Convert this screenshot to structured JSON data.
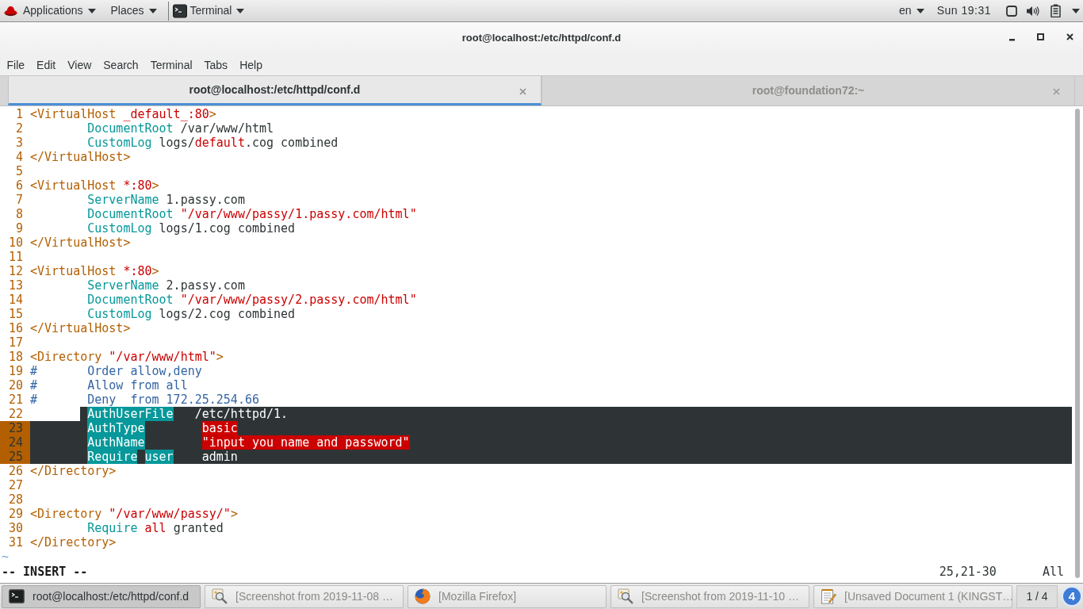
{
  "top_bar": {
    "menus": [
      {
        "label": "Applications"
      },
      {
        "label": "Places"
      }
    ],
    "app_menu": {
      "label": "Terminal"
    },
    "keyboard": "en",
    "clock": "Sun 19:31"
  },
  "window": {
    "title": "root@localhost:/etc/httpd/conf.d"
  },
  "menu_bar": [
    "File",
    "Edit",
    "View",
    "Search",
    "Terminal",
    "Tabs",
    "Help"
  ],
  "tabs": [
    {
      "label": "root@localhost:/etc/httpd/conf.d",
      "selected": true
    },
    {
      "label": "root@foundation72:~",
      "selected": false
    }
  ],
  "editor": {
    "lines": [
      {
        "number": "1",
        "selected": false,
        "segments": [
          {
            "text": "<VirtualHost ",
            "kind": "tag"
          },
          {
            "text": "_default_:80",
            "kind": "value"
          },
          {
            "text": ">",
            "kind": "tag"
          }
        ]
      },
      {
        "number": "2",
        "selected": false,
        "segments": [
          {
            "text": "        DocumentRoot",
            "kind": "keyword"
          },
          {
            "text": " /var/www/html",
            "kind": "plain"
          }
        ]
      },
      {
        "number": "3",
        "selected": false,
        "segments": [
          {
            "text": "        CustomLog",
            "kind": "keyword"
          },
          {
            "text": " logs/",
            "kind": "plain"
          },
          {
            "text": "default",
            "kind": "value"
          },
          {
            "text": ".cog combined",
            "kind": "plain"
          }
        ]
      },
      {
        "number": "4",
        "selected": false,
        "segments": [
          {
            "text": "</VirtualHost>",
            "kind": "tag"
          }
        ]
      },
      {
        "number": "5",
        "selected": false
      },
      {
        "number": "6",
        "selected": false,
        "segments": [
          {
            "text": "<VirtualHost ",
            "kind": "tag"
          },
          {
            "text": "*:80",
            "kind": "value"
          },
          {
            "text": ">",
            "kind": "tag"
          }
        ]
      },
      {
        "number": "7",
        "selected": false,
        "segments": [
          {
            "text": "        ServerName",
            "kind": "keyword"
          },
          {
            "text": " 1.passy.com",
            "kind": "plain"
          }
        ]
      },
      {
        "number": "8",
        "selected": false,
        "segments": [
          {
            "text": "        DocumentRoot",
            "kind": "keyword"
          },
          {
            "text": " \"/var/www/passy/1.passy.com/html\"",
            "kind": "value"
          }
        ]
      },
      {
        "number": "9",
        "selected": false,
        "segments": [
          {
            "text": "        CustomLog",
            "kind": "keyword"
          },
          {
            "text": " logs/1.cog combined",
            "kind": "plain"
          }
        ]
      },
      {
        "number": "10",
        "selected": false,
        "segments": [
          {
            "text": "</VirtualHost>",
            "kind": "tag"
          }
        ]
      },
      {
        "number": "11",
        "selected": false
      },
      {
        "number": "12",
        "selected": false,
        "segments": [
          {
            "text": "<VirtualHost ",
            "kind": "tag"
          },
          {
            "text": "*:80",
            "kind": "value"
          },
          {
            "text": ">",
            "kind": "tag"
          }
        ]
      },
      {
        "number": "13",
        "selected": false,
        "segments": [
          {
            "text": "        ServerName",
            "kind": "keyword"
          },
          {
            "text": " 2.passy.com",
            "kind": "plain"
          }
        ]
      },
      {
        "number": "14",
        "selected": false,
        "segments": [
          {
            "text": "        DocumentRoot",
            "kind": "keyword"
          },
          {
            "text": " \"/var/www/passy/2.passy.com/html\"",
            "kind": "value"
          }
        ]
      },
      {
        "number": "15",
        "selected": false,
        "segments": [
          {
            "text": "        CustomLog",
            "kind": "keyword"
          },
          {
            "text": " logs/2.cog combined",
            "kind": "plain"
          }
        ]
      },
      {
        "number": "16",
        "selected": false,
        "segments": [
          {
            "text": "</VirtualHost>",
            "kind": "tag"
          }
        ]
      },
      {
        "number": "17",
        "selected": false
      },
      {
        "number": "18",
        "selected": false,
        "segments": [
          {
            "text": "<Directory ",
            "kind": "tag"
          },
          {
            "text": "\"/var/www/html\"",
            "kind": "value"
          },
          {
            "text": ">",
            "kind": "tag"
          }
        ]
      },
      {
        "number": "19",
        "selected": false,
        "segments": [
          {
            "text": "#       Order allow,deny",
            "kind": "comment"
          }
        ]
      },
      {
        "number": "20",
        "selected": false,
        "segments": [
          {
            "text": "#       Allow from all",
            "kind": "comment"
          }
        ]
      },
      {
        "number": "21",
        "selected": false,
        "segments": [
          {
            "text": "#       Deny  from 172.25.254.66",
            "kind": "comment"
          }
        ]
      },
      {
        "number": "22",
        "selected": true,
        "segments": [
          {
            "text": "        AuthUserFile",
            "kind": "keyword"
          },
          {
            "text": "   /etc/httpd/1.",
            "kind": "plain"
          }
        ]
      },
      {
        "number": "23",
        "selected": true,
        "segments": [
          {
            "text": "        AuthType",
            "kind": "keyword"
          },
          {
            "text": "        basic",
            "kind": "value"
          }
        ]
      },
      {
        "number": "24",
        "selected": true,
        "segments": [
          {
            "text": "        AuthName",
            "kind": "keyword"
          },
          {
            "text": "        \"input you name and password\"",
            "kind": "value"
          }
        ]
      },
      {
        "number": "25",
        "selected": true,
        "segments": [
          {
            "text": "        Require",
            "kind": "keyword"
          },
          {
            "text": " user",
            "kind": "keyword"
          },
          {
            "text": "    admin",
            "kind": "plain"
          }
        ]
      },
      {
        "number": "26",
        "selected": false,
        "segments": [
          {
            "text": "</Directory>",
            "kind": "tag"
          }
        ]
      },
      {
        "number": "27",
        "selected": false
      },
      {
        "number": "28",
        "selected": false
      },
      {
        "number": "29",
        "selected": false,
        "segments": [
          {
            "text": "<Directory ",
            "kind": "tag"
          },
          {
            "text": "\"/var/www/passy/\"",
            "kind": "value"
          },
          {
            "text": ">",
            "kind": "tag"
          }
        ]
      },
      {
        "number": "30",
        "selected": false,
        "segments": [
          {
            "text": "        Require",
            "kind": "keyword"
          },
          {
            "text": " all",
            "kind": "value"
          },
          {
            "text": " granted",
            "kind": "plain"
          }
        ]
      },
      {
        "number": "31",
        "selected": false,
        "segments": [
          {
            "text": "</Directory>",
            "kind": "tag"
          }
        ]
      }
    ],
    "tilde": "~",
    "mode": "-- INSERT --",
    "ruler": "25,21-30",
    "position": "All"
  },
  "taskbar": {
    "items": [
      {
        "label": "root@localhost:/etc/httpd/conf.d",
        "selected": true,
        "kind": "terminal"
      },
      {
        "label": "[Screenshot from 2019-11-08 …",
        "selected": false,
        "kind": "image-viewer"
      },
      {
        "label": "[Mozilla Firefox]",
        "selected": false,
        "kind": "browser"
      },
      {
        "label": "[Screenshot from 2019-11-10 …",
        "selected": false,
        "kind": "image-viewer"
      },
      {
        "label": "[Unsaved Document 1 (KINGST…",
        "selected": false,
        "kind": "text-editor"
      }
    ],
    "workspace": "1 / 4",
    "notifications": "4"
  }
}
